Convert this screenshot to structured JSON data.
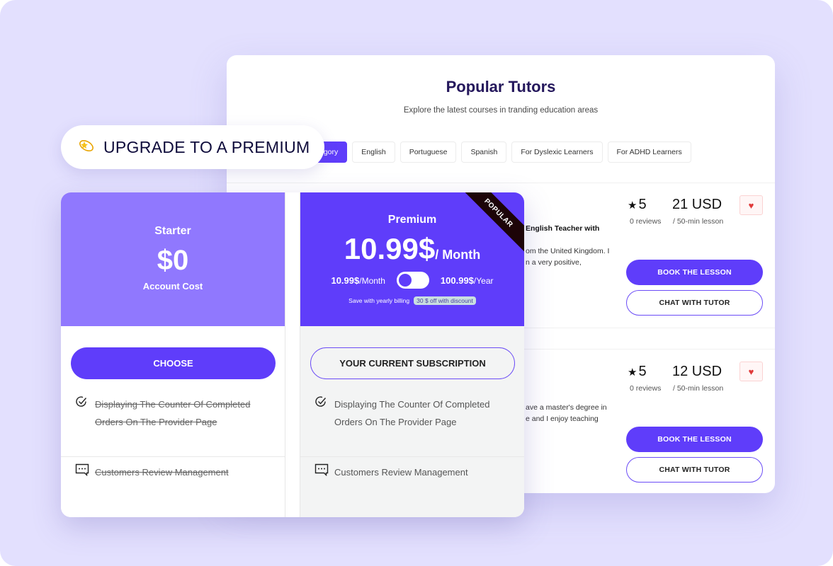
{
  "tutors_panel": {
    "title": "Popular Tutors",
    "subtitle": "Explore the latest courses in tranding education areas",
    "categories": [
      {
        "label": "egory",
        "active": true
      },
      {
        "label": "English",
        "active": false
      },
      {
        "label": "Portuguese",
        "active": false
      },
      {
        "label": "Spanish",
        "active": false
      },
      {
        "label": "For Dyslexic Learners",
        "active": false
      },
      {
        "label": "For ADHD Learners",
        "active": false
      }
    ],
    "tutors": [
      {
        "headline": "English Teacher with",
        "description": [
          "om the United Kingdom. I",
          "n a very positive,"
        ],
        "rating": "5",
        "reviews": "0 reviews",
        "price": "21 USD",
        "per": "/ 50-min lesson",
        "book_label": "BOOK THE LESSON",
        "chat_label": "CHAT WITH TUTOR"
      },
      {
        "headline": "",
        "description": [
          "ave a master's degree in",
          "e and I enjoy teaching"
        ],
        "rating": "5",
        "reviews": "0 reviews",
        "price": "12 USD",
        "per": "/ 50-min lesson",
        "book_label": "BOOK THE LESSON",
        "chat_label": "CHAT WITH TUTOR"
      }
    ]
  },
  "upgrade": {
    "icon": "dizzy-star-icon",
    "label": "UPGRADE TO A PREMIUM"
  },
  "plans": {
    "starter": {
      "name": "Starter",
      "price": "$0",
      "caption": "Account Cost",
      "button_label": "CHOOSE",
      "features": [
        {
          "text": "Displaying The Counter Of Completed Orders On The Provider Page",
          "icon": "check-circle-icon",
          "included": false
        },
        {
          "text": "Customers Review Management",
          "icon": "chat-dots-icon",
          "included": false
        }
      ]
    },
    "premium": {
      "name": "Premium",
      "price": "10.99$",
      "price_unit": "/ Month",
      "ribbon": "POPULAR",
      "monthly_price": "10.99$",
      "monthly_unit": "/Month",
      "yearly_price": "100.99$",
      "yearly_unit": "/Year",
      "billing_toggle": "monthly",
      "save_text": "Save with yearly billing",
      "discount_badge": "30 $ off with discount",
      "button_label": "YOUR CURRENT SUBSCRIPTION",
      "features": [
        {
          "text": "Displaying The Counter Of Completed Orders On The Provider Page",
          "icon": "check-circle-icon",
          "included": true
        },
        {
          "text": "Customers Review Management",
          "icon": "chat-dots-icon",
          "included": true
        }
      ]
    }
  },
  "colors": {
    "background": "#e3e0fe",
    "accent": "#5f3dfa",
    "starter_header": "#9078fe",
    "ribbon": "#1d0408",
    "heart": "#e03a3a"
  }
}
